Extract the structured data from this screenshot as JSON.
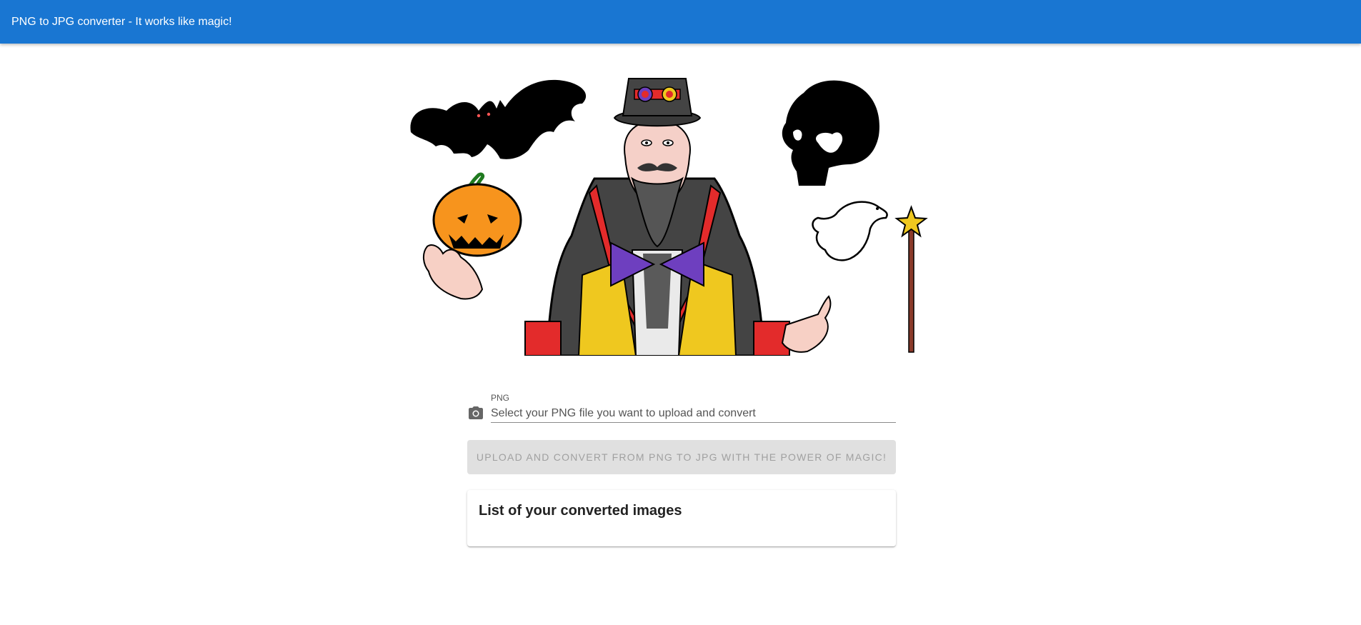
{
  "app_bar": {
    "title": "PNG to JPG converter - It works like magic!",
    "color": "#1976d2"
  },
  "hero": {
    "figures": [
      "bat",
      "magician",
      "skull",
      "pumpkin",
      "dove",
      "magic-wand"
    ]
  },
  "upload_form": {
    "field_label": "PNG",
    "field_placeholder": "Select your PNG file you want to upload and convert",
    "field_icon": "camera-icon",
    "button_label": "Upload and convert from PNG to JPG with the power of magic!",
    "button_disabled": true
  },
  "converted_list": {
    "title": "List of your converted images",
    "items": []
  }
}
